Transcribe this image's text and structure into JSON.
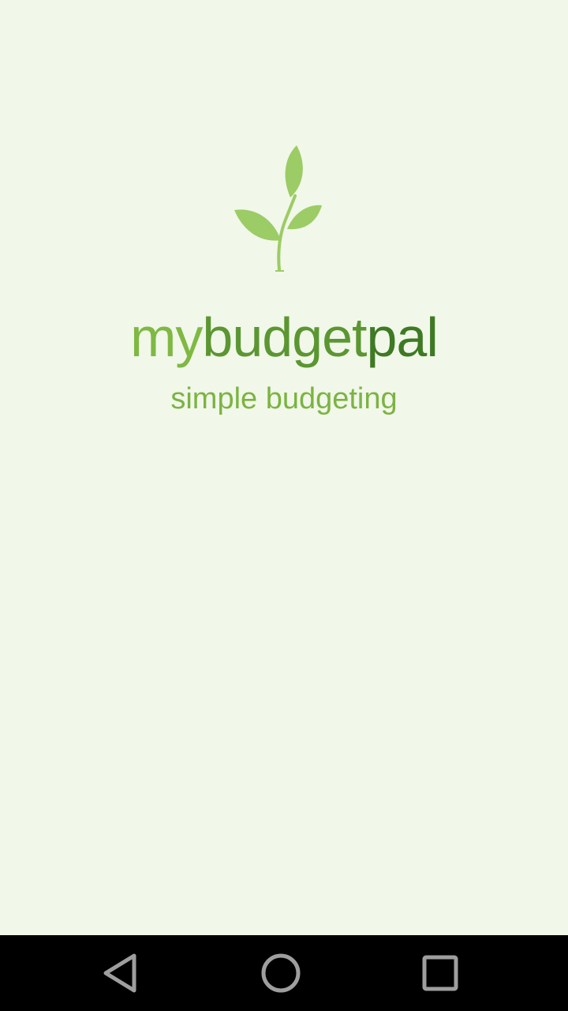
{
  "app": {
    "brand_part1": "my",
    "brand_part2": "budget",
    "brand_part3": "pal",
    "tagline": "simple budgeting"
  },
  "colors": {
    "background": "#f1f7e9",
    "brand_light": "#7fb843",
    "brand_mid": "#5b9632",
    "brand_dark": "#3e7a24",
    "tagline": "#7cb342",
    "leaf": "#9ccc65",
    "navbar": "#000000",
    "nav_icon": "#9e9e9e"
  },
  "icons": {
    "logo": "sprout-icon",
    "back": "back-triangle-icon",
    "home": "home-circle-icon",
    "recents": "recents-square-icon"
  }
}
